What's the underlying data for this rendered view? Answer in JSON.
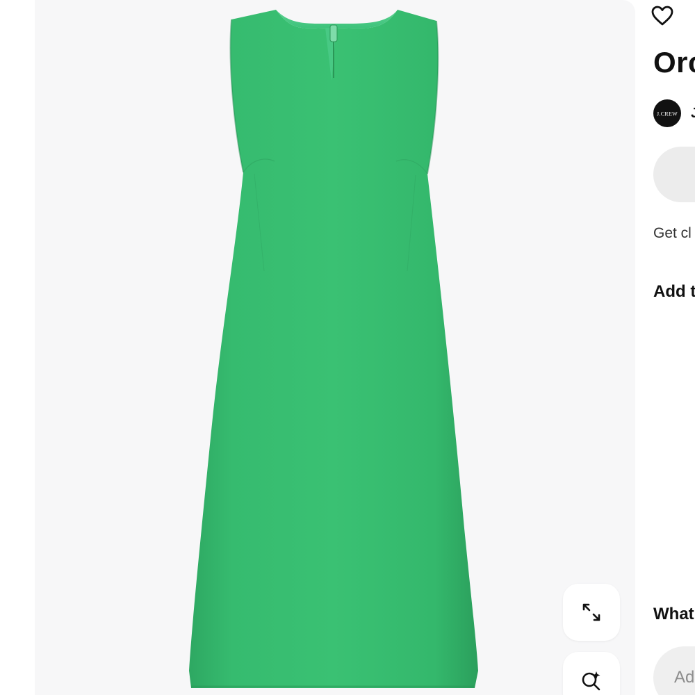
{
  "product": {
    "image_alt": "Green sleeveless sheath dress",
    "dress_color": "#33b86b",
    "background_color": "#f7f7f8"
  },
  "media_controls": {
    "expand_icon": "expand-arrows-icon",
    "visual_search_icon": "visual-search-icon"
  },
  "details": {
    "save_icon": "heart-outline-icon",
    "title": "Orc",
    "brand_logo_text": "J.CREW",
    "brand_name": "J",
    "helper_text": "Get cl",
    "add_label": "Add t",
    "comments_label": "What",
    "comment_placeholder": "Ad"
  }
}
